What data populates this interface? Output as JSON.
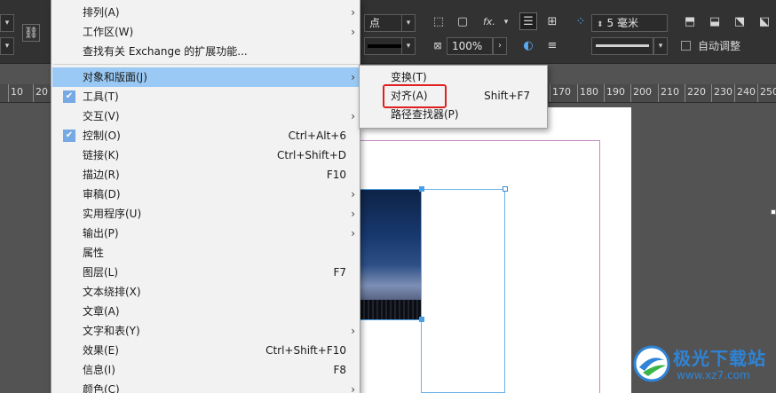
{
  "control_bar": {
    "link_icon": "chain-link-icon",
    "stroke_units": "点",
    "fx_label": "fx.",
    "opacity_value": "100%",
    "spacing_value": "5 毫米",
    "auto_fit_label": "自动调整"
  },
  "ruler": {
    "left_numbers": [
      "10",
      "20"
    ],
    "right_numbers": [
      "170",
      "180",
      "190",
      "200",
      "210",
      "220",
      "230",
      "240",
      "250",
      "26"
    ]
  },
  "main_menu": {
    "items": [
      {
        "label": "排列(A)",
        "shortcut": "",
        "submenu": true,
        "checked": false,
        "highlighted": false
      },
      {
        "label": "工作区(W)",
        "shortcut": "",
        "submenu": true,
        "checked": false,
        "highlighted": false
      },
      {
        "label": "查找有关 Exchange 的扩展功能...",
        "shortcut": "",
        "submenu": false,
        "checked": false,
        "highlighted": false
      },
      {
        "label": "对象和版面(J)",
        "shortcut": "",
        "submenu": true,
        "checked": false,
        "highlighted": true
      },
      {
        "label": "工具(T)",
        "shortcut": "",
        "submenu": false,
        "checked": true,
        "highlighted": false
      },
      {
        "label": "交互(V)",
        "shortcut": "",
        "submenu": true,
        "checked": false,
        "highlighted": false
      },
      {
        "label": "控制(O)",
        "shortcut": "Ctrl+Alt+6",
        "submenu": false,
        "checked": true,
        "highlighted": false
      },
      {
        "label": "链接(K)",
        "shortcut": "Ctrl+Shift+D",
        "submenu": false,
        "checked": false,
        "highlighted": false
      },
      {
        "label": "描边(R)",
        "shortcut": "F10",
        "submenu": false,
        "checked": false,
        "highlighted": false
      },
      {
        "label": "审稿(D)",
        "shortcut": "",
        "submenu": true,
        "checked": false,
        "highlighted": false
      },
      {
        "label": "实用程序(U)",
        "shortcut": "",
        "submenu": true,
        "checked": false,
        "highlighted": false
      },
      {
        "label": "输出(P)",
        "shortcut": "",
        "submenu": true,
        "checked": false,
        "highlighted": false
      },
      {
        "label": "属性",
        "shortcut": "",
        "submenu": false,
        "checked": false,
        "highlighted": false
      },
      {
        "label": "图层(L)",
        "shortcut": "F7",
        "submenu": false,
        "checked": false,
        "highlighted": false
      },
      {
        "label": "文本绕排(X)",
        "shortcut": "",
        "submenu": false,
        "checked": false,
        "highlighted": false
      },
      {
        "label": "文章(A)",
        "shortcut": "",
        "submenu": false,
        "checked": false,
        "highlighted": false
      },
      {
        "label": "文字和表(Y)",
        "shortcut": "",
        "submenu": true,
        "checked": false,
        "highlighted": false
      },
      {
        "label": "效果(E)",
        "shortcut": "Ctrl+Shift+F10",
        "submenu": false,
        "checked": false,
        "highlighted": false
      },
      {
        "label": "信息(I)",
        "shortcut": "F8",
        "submenu": false,
        "checked": false,
        "highlighted": false
      },
      {
        "label": "颜色(C)",
        "shortcut": "",
        "submenu": true,
        "checked": false,
        "highlighted": false
      }
    ]
  },
  "sub_menu": {
    "items": [
      {
        "label": "变换(T)",
        "shortcut": ""
      },
      {
        "label": "对齐(A)",
        "shortcut": "Shift+F7"
      },
      {
        "label": "路径查找器(P)",
        "shortcut": ""
      }
    ]
  },
  "watermark": {
    "title": "极光下载站",
    "url": "www.xz7.com"
  },
  "colors": {
    "highlight": "#99c9f4",
    "annotation_red": "#e02020",
    "selection_blue": "#4aa0e6"
  }
}
